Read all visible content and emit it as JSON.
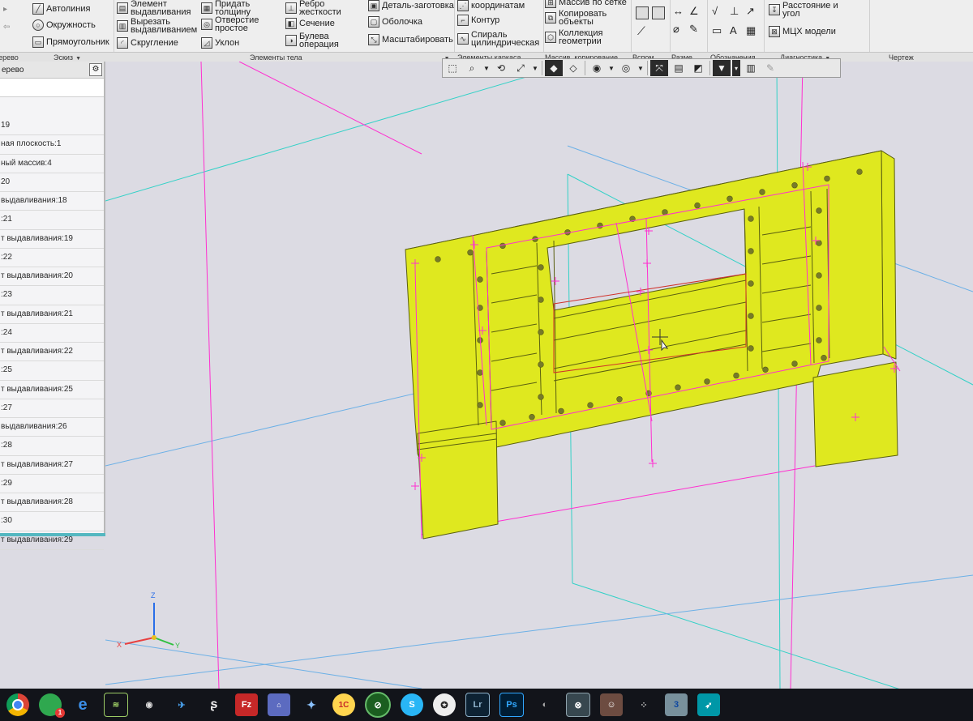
{
  "colors": {
    "model": "#dfe81f",
    "model_edge": "#5a5f10",
    "sketch": "#ff2fd0",
    "plane_cyan": "#33d1c7",
    "plane_blue": "#6cb0e6",
    "viewport_bg": "#dcdbe3"
  },
  "ribbon": {
    "col1": [
      "Автолиния",
      "Окружность",
      "Прямоугольник"
    ],
    "col2": [
      "Элемент выдавливания",
      "Вырезать выдавливанием",
      "Скругление"
    ],
    "col3": [
      "Придать толщину",
      "Отверстие простое",
      "Уклон"
    ],
    "col4": [
      "Ребро жесткости",
      "Сечение",
      "Булева операция"
    ],
    "col5": [
      "Деталь-заготовка",
      "Оболочка",
      "Масштабировать"
    ],
    "col6": [
      "координатам",
      "Контур",
      "Спираль цилиндрическая"
    ],
    "col7": [
      "Массив по сетке",
      "Копировать объекты",
      "Коллекция геометрии"
    ],
    "col8": [
      "Расстояние и угол",
      "МЦХ модели"
    ],
    "captions": {
      "tree": "Дерево",
      "sketch": "Эскиз",
      "body": "Элементы тела",
      "frame": "Элементы каркаса",
      "array": "Массив, копирование",
      "aux": "Вспом...",
      "dims": "Разме...",
      "notes": "Обозначения",
      "diag": "Диагностика",
      "drawing": "Чертеж"
    }
  },
  "view_toolbar": {
    "icons": [
      "select-icon",
      "zoom-icon",
      "rotate-icon",
      "orient-icon",
      "shaded-icon",
      "wireframe-icon",
      "visibility-icon",
      "hidden-icon",
      "section-icon",
      "filter-icon",
      "layout-icon",
      "pen-icon"
    ]
  },
  "tree_panel": {
    "title": "ерево",
    "items": [
      "19",
      "ная плоскость:1",
      "ный массив:4",
      "20",
      "выдавливания:18",
      ":21",
      "т выдавливания:19",
      ":22",
      "т выдавливания:20",
      ":23",
      "т выдавливания:21",
      ":24",
      "т выдавливания:22",
      ":25",
      "т выдавливания:25",
      ":27",
      "выдавливания:26",
      ":28",
      "т выдавливания:27",
      ":29",
      "т выдавливания:28",
      ":30",
      "т выдавливания:29"
    ]
  },
  "axis": {
    "x": "X",
    "y": "Y",
    "z": "Z"
  },
  "taskbar": {
    "items": [
      "chrome-icon",
      "chat-icon",
      "edge-icon",
      "store-icon",
      "obs-icon",
      "kompas-icon",
      "s-app-icon",
      "filezilla-icon",
      "sketchup-icon",
      "bat-icon",
      "1c-icon",
      "browser-icon",
      "skype-icon",
      "star-icon",
      "lightroom-icon",
      "photoshop-icon",
      "audio-icon",
      "kompas3d-icon",
      "person-icon",
      "dots-icon",
      "three-icon",
      "bird-icon"
    ],
    "badge": "1",
    "labels": {
      "lightroom": "Lr",
      "photoshop": "Ps",
      "filezilla": "Fz",
      "three": "3"
    }
  }
}
